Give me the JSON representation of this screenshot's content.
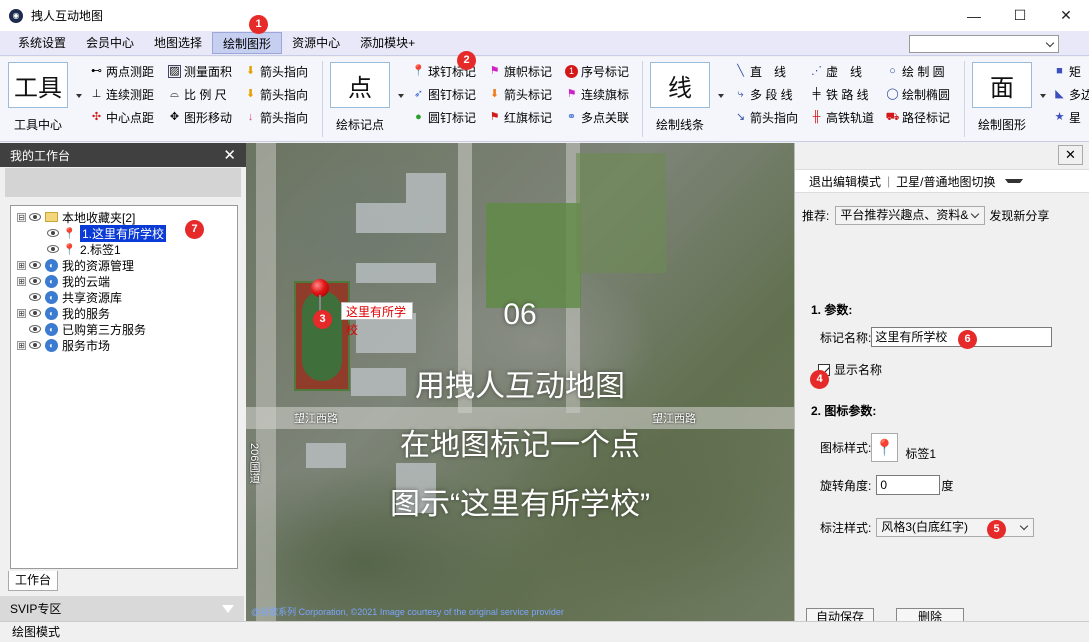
{
  "window": {
    "title": "拽人互动地图",
    "minimize_glyph": "—",
    "maximize_glyph": "☐",
    "close_glyph": "✕"
  },
  "menu": {
    "items": [
      "系统设置",
      "会员中心",
      "地图选择",
      "绘制图形",
      "资源中心",
      "添加模块+"
    ],
    "active_index": 3
  },
  "ribbon": {
    "tool_center": {
      "big": "工具",
      "label": "工具中心"
    },
    "tools": [
      "两点测距",
      "测量面积",
      "箭头指向",
      "连续测距",
      "比 例 尺",
      "箭头指向",
      "中心点距",
      "图形移动",
      "箭头指向"
    ],
    "point": {
      "big": "点",
      "label": "绘标记点"
    },
    "point_items": [
      "球钉标记",
      "旗帜标记",
      "序号标记",
      "图钉标记",
      "箭头标记",
      "连续旗标",
      "圆钉标记",
      "红旗标记",
      "多点关联"
    ],
    "line": {
      "big": "线",
      "label": "绘制线条"
    },
    "line_items": [
      "直　线",
      "虚　线",
      "绘 制 圆",
      "多 段 线",
      "铁 路 线",
      "绘制椭圆",
      "箭头指向",
      "高铁轨道",
      "路径标记"
    ],
    "area": {
      "big": "面",
      "label": "绘制图形"
    },
    "area_items": [
      "矩",
      "多边",
      "星"
    ]
  },
  "left_panel": {
    "title": "我的工作台",
    "tree": [
      {
        "label": "本地收藏夹[2]",
        "icon": "folder-icon",
        "expander": "⊟",
        "level": 0
      },
      {
        "label": "1.这里有所学校",
        "icon": "pin-icon",
        "level": 1,
        "selected": true
      },
      {
        "label": "2.标签1",
        "icon": "pin-icon",
        "level": 1
      },
      {
        "label": "我的资源管理",
        "icon": "globe-icon",
        "expander": "⊞",
        "level": 0
      },
      {
        "label": "我的云端",
        "icon": "globe-icon",
        "expander": "⊞",
        "level": 0
      },
      {
        "label": "共享资源库",
        "icon": "globe-icon",
        "level": 0
      },
      {
        "label": "我的服务",
        "icon": "globe-icon",
        "expander": "⊞",
        "level": 0
      },
      {
        "label": "已购第三方服务",
        "icon": "globe-icon",
        "level": 0
      },
      {
        "label": "服务市场",
        "icon": "globe-icon",
        "expander": "⊞",
        "level": 0
      }
    ],
    "tab": "工作台",
    "svip": "SVIP专区"
  },
  "map": {
    "marker_label": "这里有所学校",
    "overlay_lines": [
      "06",
      "用拽人互动地图",
      "在地图标记一个点",
      "图示“这里有所学校”"
    ],
    "road_labels": [
      "望江西路",
      "望江西路",
      "206国道"
    ],
    "copyright": "@谷歌系列 Corporation, ©2021 Image courtesy of the original service provider"
  },
  "right_panel": {
    "close_glyph": "✕",
    "toolbar": [
      "退出编辑模式",
      "卫星/普通地图切换"
    ],
    "recommend_label": "推荐:",
    "recommend_value": "平台推荐兴趣点、资料&",
    "discover": "发现新分享",
    "section1": "1. 参数:",
    "name_label": "标记名称:",
    "name_value": "这里有所学校",
    "show_name_label": "显示名称",
    "show_name_checked": true,
    "section2": "2. 图标参数:",
    "icon_style_label": "图标样式:",
    "icon_name": "标签1",
    "rotate_label": "旋转角度:",
    "rotate_value": "0",
    "rotate_unit": "度",
    "label_style_label": "标注样式:",
    "label_style_value": "风格3(白底红字)",
    "buttons": [
      "自动保存",
      "删除"
    ]
  },
  "status": {
    "text": "绘图模式"
  },
  "badges": [
    "1",
    "2",
    "3",
    "4",
    "5",
    "6",
    "7"
  ],
  "colors": {
    "accent": "#e62a2a",
    "menu_bg": "#e8e8f8",
    "selected": "#0a3bd6"
  }
}
